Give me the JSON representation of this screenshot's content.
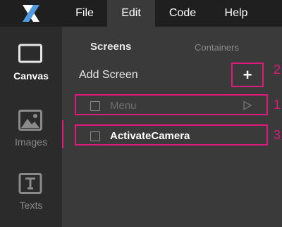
{
  "app": {
    "logo_icon": "x-logo-icon"
  },
  "menu": {
    "items": [
      {
        "label": "File"
      },
      {
        "label": "Edit"
      },
      {
        "label": "Code"
      },
      {
        "label": "Help"
      }
    ],
    "active_index": 1
  },
  "sidebar": {
    "items": [
      {
        "label": "Canvas",
        "icon": "canvas-icon"
      },
      {
        "label": "Images",
        "icon": "image-icon"
      },
      {
        "label": "Texts",
        "icon": "text-icon"
      }
    ],
    "active_index": 0
  },
  "panel": {
    "tabs": [
      {
        "label": "Screens"
      },
      {
        "label": "Containers"
      }
    ],
    "add_screen_label": "Add Screen",
    "add_button_symbol": "+",
    "screens": [
      {
        "label": "Menu",
        "dimmed": true,
        "play_icon": "play-icon"
      },
      {
        "label": "ActivateCamera",
        "dimmed": false
      }
    ]
  },
  "annotations": [
    "1",
    "2",
    "3"
  ],
  "colors": {
    "topbar": "#1f1f1f",
    "sidebar": "#2b2b2b",
    "panel": "#3a3a3a",
    "highlight": "#e0197d"
  }
}
